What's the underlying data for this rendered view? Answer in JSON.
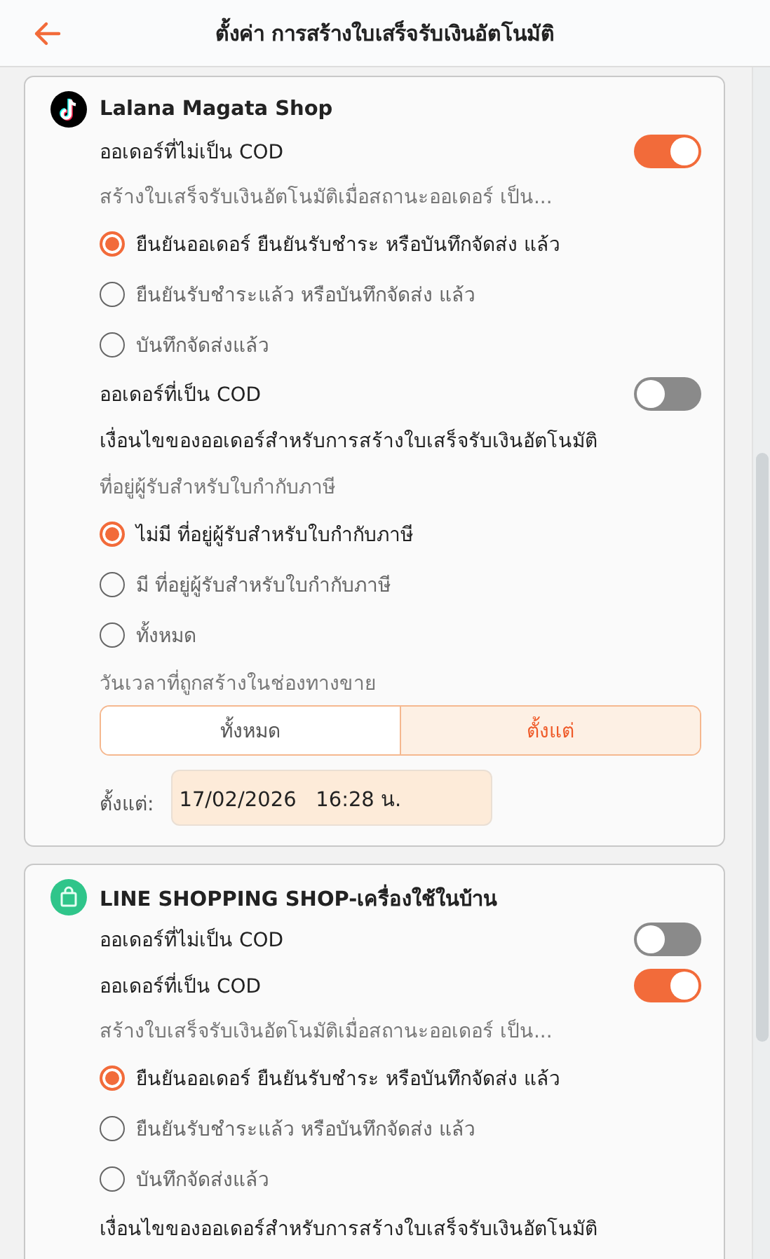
{
  "header": {
    "title": "ตั้งค่า การสร้างใบเสร็จรับเงินอัตโนมัติ"
  },
  "shops": [
    {
      "name": "Lalana Magata Shop",
      "items": [
        {
          "kind": "toggle",
          "label": "ออเดอร์ที่ไม่เป็น COD",
          "on": true
        },
        {
          "kind": "hint",
          "text": "สร้างใบเสร็จรับเงินอัตโนมัติเมื่อสถานะออเดอร์ เป็น..."
        },
        {
          "kind": "radio",
          "label": "ยืนยันออเดอร์ ยืนยันรับชำระ หรือบันทึกจัดส่ง แล้ว",
          "selected": true
        },
        {
          "kind": "radio",
          "label": "ยืนยันรับชำระแล้ว หรือบันทึกจัดส่ง แล้ว",
          "selected": false
        },
        {
          "kind": "radio",
          "label": "บันทึกจัดส่งแล้ว",
          "selected": false
        },
        {
          "kind": "toggle",
          "label": "ออเดอร์ที่เป็น COD",
          "on": false
        },
        {
          "kind": "heading",
          "text": "เงื่อนไขของออเดอร์สำหรับการสร้างใบเสร็จรับเงินอัตโนมัติ"
        },
        {
          "kind": "hint",
          "text": "ที่อยู่ผู้รับสำหรับใบกำกับภาษี"
        },
        {
          "kind": "radio",
          "label": "ไม่มี ที่อยู่ผู้รับสำหรับใบกำกับภาษี",
          "selected": true
        },
        {
          "kind": "radio",
          "label": "มี ที่อยู่ผู้รับสำหรับใบกำกับภาษี",
          "selected": false
        },
        {
          "kind": "radio",
          "label": "ทั้งหมด",
          "selected": false
        },
        {
          "kind": "hint",
          "text": "วันเวลาที่ถูกสร้างในช่องทางขาย"
        },
        {
          "kind": "segmented",
          "options": [
            {
              "label": "ทั้งหมด",
              "selected": false
            },
            {
              "label": "ตั้งแต่",
              "selected": true
            }
          ]
        },
        {
          "kind": "date",
          "label": "ตั้งแต่:",
          "value": "17/02/2026   16:28 น."
        }
      ]
    },
    {
      "name": "LINE SHOPPING SHOP-เครื่องใช้ในบ้าน",
      "items": [
        {
          "kind": "toggle",
          "label": "ออเดอร์ที่ไม่เป็น COD",
          "on": false
        },
        {
          "kind": "toggle",
          "label": "ออเดอร์ที่เป็น COD",
          "on": true
        },
        {
          "kind": "hint",
          "text": "สร้างใบเสร็จรับเงินอัตโนมัติเมื่อสถานะออเดอร์ เป็น..."
        },
        {
          "kind": "radio",
          "label": "ยืนยันออเดอร์ ยืนยันรับชำระ หรือบันทึกจัดส่ง แล้ว",
          "selected": true
        },
        {
          "kind": "radio",
          "label": "ยืนยันรับชำระแล้ว หรือบันทึกจัดส่ง แล้ว",
          "selected": false
        },
        {
          "kind": "radio",
          "label": "บันทึกจัดส่งแล้ว",
          "selected": false
        },
        {
          "kind": "heading",
          "text": "เงื่อนไขของออเดอร์สำหรับการสร้างใบเสร็จรับเงินอัตโนมัติ"
        }
      ]
    }
  ]
}
